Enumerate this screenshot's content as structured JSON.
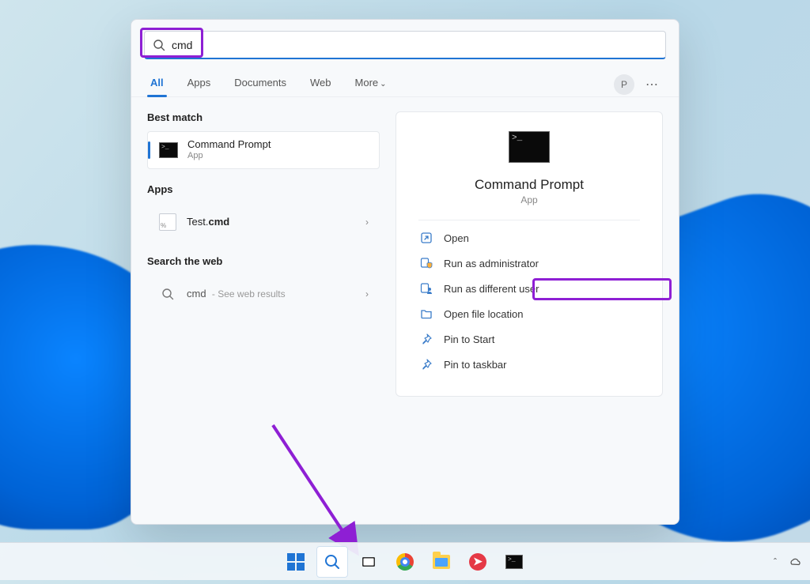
{
  "search": {
    "value": "cmd"
  },
  "tabs": {
    "all": "All",
    "apps": "Apps",
    "documents": "Documents",
    "web": "Web",
    "more": "More"
  },
  "avatar_initial": "P",
  "left": {
    "best_match_label": "Best match",
    "best_result": {
      "title": "Command Prompt",
      "sub": "App"
    },
    "apps_label": "Apps",
    "app_result": {
      "prefix": "Test.",
      "bold": "cmd"
    },
    "web_label": "Search the web",
    "web_result": {
      "query": "cmd",
      "hint": "See web results"
    }
  },
  "detail": {
    "title": "Command Prompt",
    "sub": "App",
    "actions": {
      "open": "Open",
      "run_admin": "Run as administrator",
      "run_diff": "Run as different user",
      "open_loc": "Open file location",
      "pin_start": "Pin to Start",
      "pin_taskbar": "Pin to taskbar"
    }
  }
}
